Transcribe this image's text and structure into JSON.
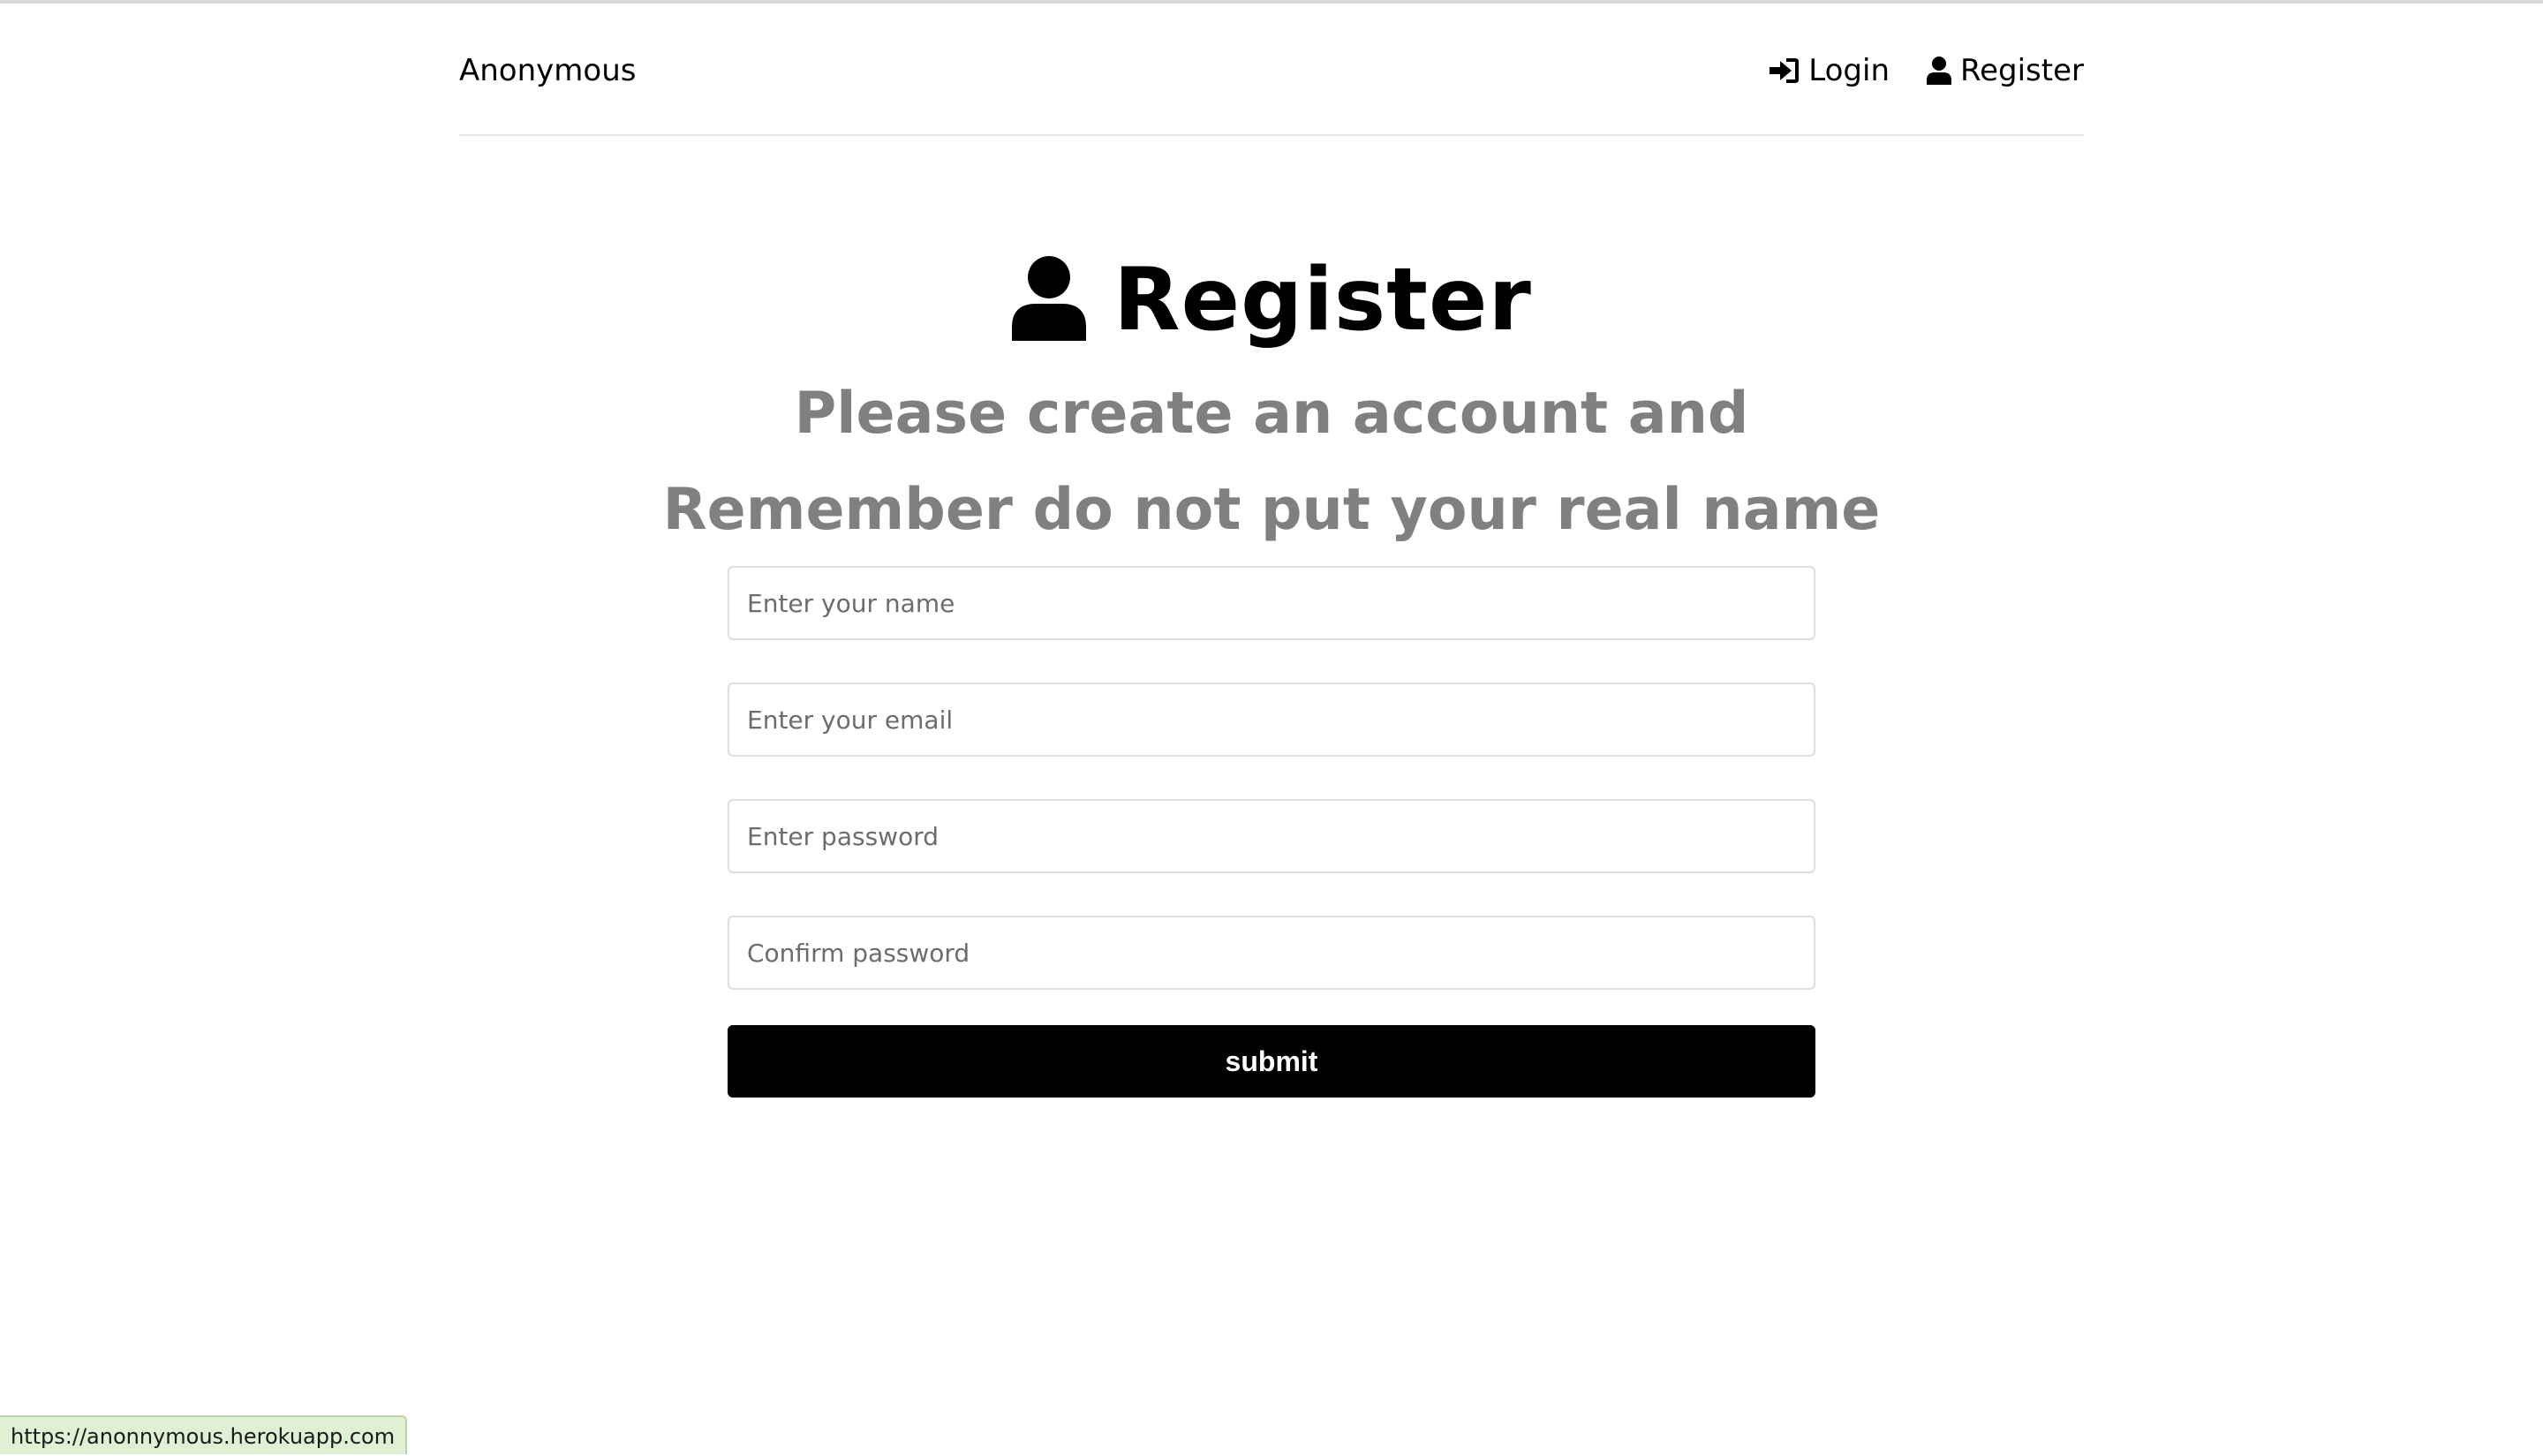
{
  "navbar": {
    "brand": "Anonymous",
    "links": [
      {
        "label": "Login",
        "icon": "sign-in-icon"
      },
      {
        "label": "Register",
        "icon": "user-icon"
      }
    ]
  },
  "page": {
    "title": "Register",
    "title_icon": "user-icon",
    "subtitle_line1": "Please create an account and",
    "subtitle_line2": "Remember do not put your real name"
  },
  "form": {
    "name_placeholder": "Enter your name",
    "email_placeholder": "Enter your email",
    "password_placeholder": "Enter password",
    "confirm_placeholder": "Confirm password",
    "submit_label": "submit"
  },
  "status_bar": {
    "url": "https://anonnymous.herokuapp.com"
  },
  "colors": {
    "button_bg": "#000000",
    "subtitle": "#808080",
    "status_bg": "#dff0d4"
  }
}
